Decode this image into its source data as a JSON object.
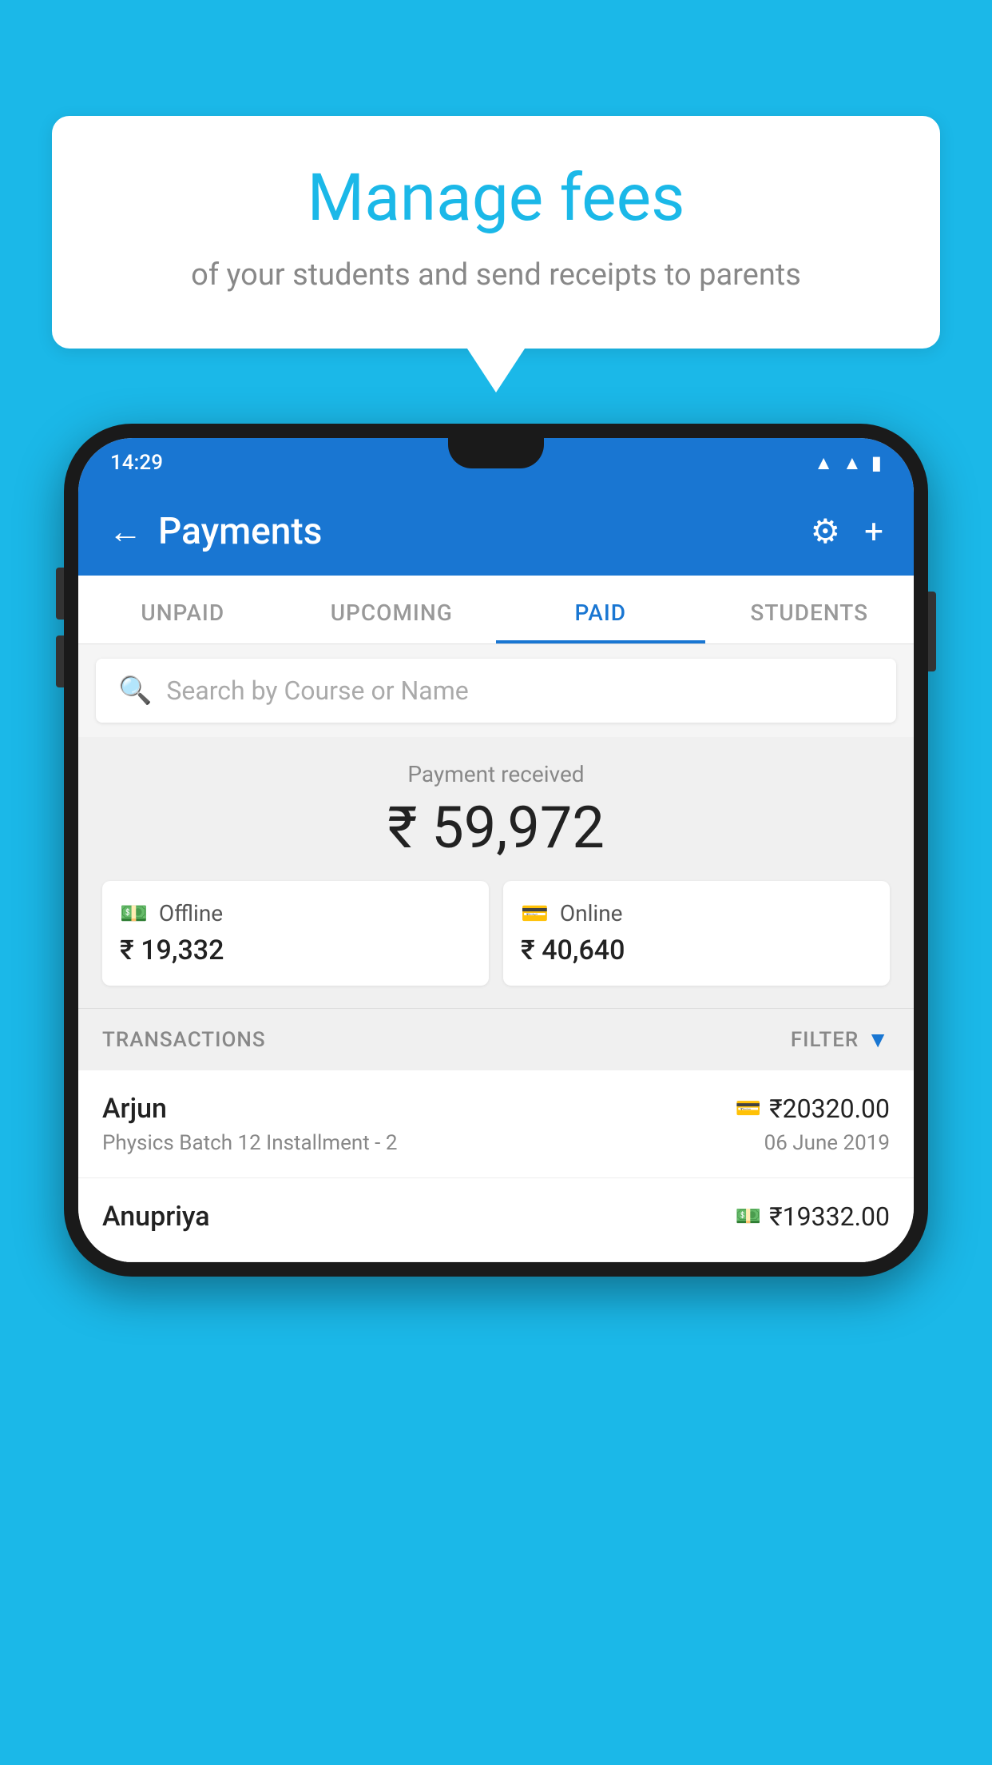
{
  "background_color": "#1BB8E8",
  "bubble": {
    "title": "Manage fees",
    "subtitle": "of your students and send receipts to parents"
  },
  "status_bar": {
    "time": "14:29",
    "icons": [
      "wifi",
      "signal",
      "battery"
    ]
  },
  "app_bar": {
    "title": "Payments",
    "back_label": "←",
    "settings_label": "⚙",
    "add_label": "+"
  },
  "tabs": [
    {
      "label": "UNPAID",
      "active": false
    },
    {
      "label": "UPCOMING",
      "active": false
    },
    {
      "label": "PAID",
      "active": true
    },
    {
      "label": "STUDENTS",
      "active": false
    }
  ],
  "search": {
    "placeholder": "Search by Course or Name"
  },
  "payment_summary": {
    "label": "Payment received",
    "total": "₹ 59,972",
    "offline": {
      "type": "Offline",
      "amount": "₹ 19,332"
    },
    "online": {
      "type": "Online",
      "amount": "₹ 40,640"
    }
  },
  "transactions_section": {
    "label": "TRANSACTIONS",
    "filter_label": "FILTER"
  },
  "transactions": [
    {
      "name": "Arjun",
      "amount": "₹20320.00",
      "course": "Physics Batch 12 Installment - 2",
      "date": "06 June 2019",
      "payment_type": "online"
    },
    {
      "name": "Anupriya",
      "amount": "₹19332.00",
      "course": "",
      "date": "",
      "payment_type": "offline"
    }
  ]
}
